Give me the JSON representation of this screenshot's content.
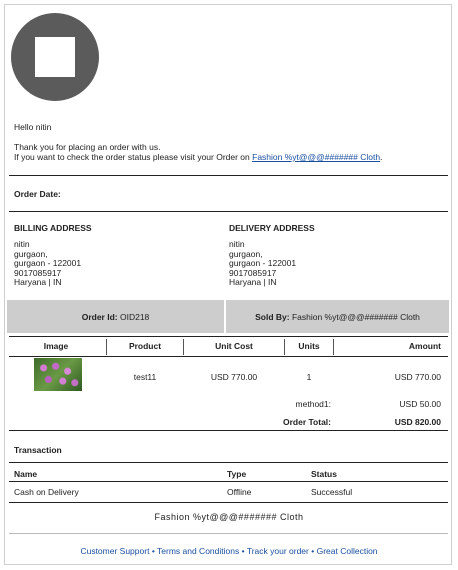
{
  "greeting": "Hello nitin",
  "thanks": "Thank you for placing an order with us.",
  "status_prefix": "If you want to check the order status please visit your Order on",
  "store_link": "Fashion %yt@@@####### Cloth",
  "status_suffix": ".",
  "order_date_label": "Order Date:",
  "billing": {
    "title": "BILLING ADDRESS",
    "lines": [
      "nitin",
      "gurgaon,",
      "gurgaon - 122001",
      "9017085917",
      "Haryana | IN"
    ]
  },
  "delivery": {
    "title": "DELIVERY ADDRESS",
    "lines": [
      "nitin",
      "gurgaon,",
      "gurgaon - 122001",
      "9017085917",
      "Haryana | IN"
    ]
  },
  "order_id_label": "Order Id:",
  "order_id": "OID218",
  "sold_by_label": "Sold By:",
  "sold_by": "Fashion %yt@@@####### Cloth",
  "table": {
    "headers": [
      "Image",
      "Product",
      "Unit Cost",
      "Units",
      "Amount"
    ],
    "row": {
      "product": "test11",
      "unit_cost": "USD 770.00",
      "units": "1",
      "amount": "USD 770.00"
    },
    "shipping_label": "method1:",
    "shipping_amount": "USD 50.00",
    "total_label": "Order Total:",
    "total_amount": "USD 820.00"
  },
  "transaction": {
    "title": "Transaction",
    "headers": [
      "Name",
      "Type",
      "Status"
    ],
    "row": [
      "Cash on Delivery",
      "Offline",
      "Successful"
    ]
  },
  "footer_brand": "Fashion %yt@@@####### Cloth",
  "footer_links": [
    "Customer Support",
    "Terms and Conditions",
    "Track your order",
    "Great Collection"
  ],
  "footer_sep": "•"
}
